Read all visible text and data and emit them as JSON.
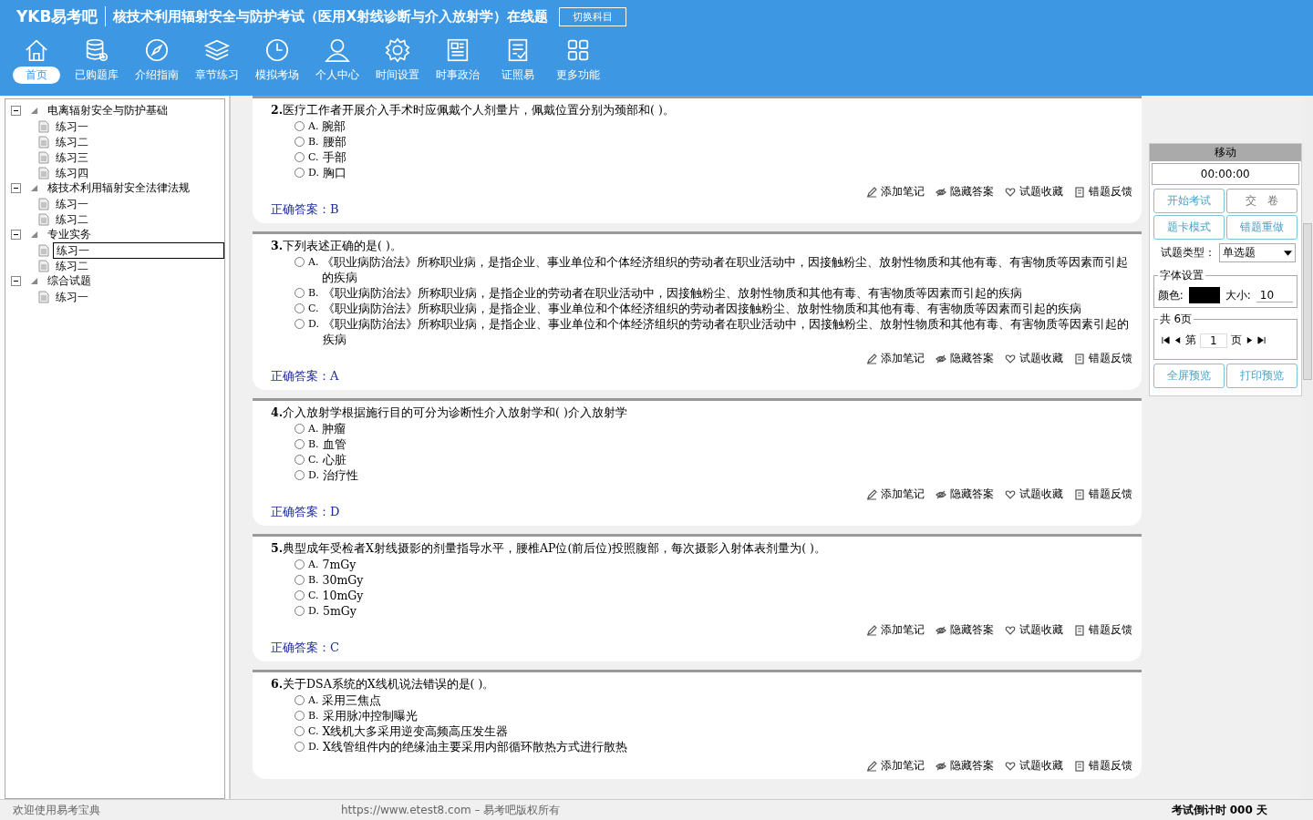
{
  "header": {
    "logo": "YKB易考吧",
    "title": "核技术利用辐射安全与防护考试（医用X射线诊断与介入放射学）在线题",
    "switch_button": "切换科目"
  },
  "toolbar": [
    {
      "kind": "home",
      "label": "首页",
      "selected": true
    },
    {
      "kind": "database",
      "label": "已购题库",
      "selected": false
    },
    {
      "kind": "compass",
      "label": "介绍指南",
      "selected": false
    },
    {
      "kind": "layers",
      "label": "章节练习",
      "selected": false
    },
    {
      "kind": "clock",
      "label": "模拟考场",
      "selected": false
    },
    {
      "kind": "user",
      "label": "个人中心",
      "selected": false
    },
    {
      "kind": "gear",
      "label": "时间设置",
      "selected": false
    },
    {
      "kind": "news",
      "label": "时事政治",
      "selected": false
    },
    {
      "kind": "checklist",
      "label": "证照易",
      "selected": false
    },
    {
      "kind": "grid",
      "label": "更多功能",
      "selected": false
    }
  ],
  "tree": [
    {
      "label": "电离辐射安全与防护基础",
      "expanded": true,
      "children": [
        {
          "label": "练习一",
          "selected": false
        },
        {
          "label": "练习二",
          "selected": false
        },
        {
          "label": "练习三",
          "selected": false
        },
        {
          "label": "练习四",
          "selected": false
        }
      ]
    },
    {
      "label": "核技术利用辐射安全法律法规",
      "expanded": true,
      "children": [
        {
          "label": "练习一",
          "selected": false
        },
        {
          "label": "练习二",
          "selected": false
        }
      ]
    },
    {
      "label": "专业实务",
      "expanded": true,
      "children": [
        {
          "label": "练习一",
          "selected": true
        },
        {
          "label": "练习二",
          "selected": false
        }
      ]
    },
    {
      "label": "综合试题",
      "expanded": true,
      "children": [
        {
          "label": "练习一",
          "selected": false
        }
      ]
    }
  ],
  "questions": [
    {
      "number": "2.",
      "text": "医疗工作者开展介入手术时应佩戴个人剂量片，佩戴位置分别为颈部和( )。",
      "options": [
        {
          "letter": "A.",
          "text": "腕部",
          "selected": false
        },
        {
          "letter": "B.",
          "text": "腰部",
          "selected": false
        },
        {
          "letter": "C.",
          "text": "手部",
          "selected": false
        },
        {
          "letter": "D.",
          "text": "胸口",
          "selected": false
        }
      ],
      "actions": [
        "添加笔记",
        "隐藏答案",
        "试题收藏",
        "错题反馈"
      ],
      "answer_label": "正确答案：",
      "answer": "B"
    },
    {
      "number": "3.",
      "text": "下列表述正确的是( )。",
      "options": [
        {
          "letter": "A.",
          "text": "《职业病防治法》所称职业病，是指企业、事业单位和个体经济组织的劳动者在职业活动中，因接触粉尘、放射性物质和其他有毒、有害物质等因素而引起的疾病",
          "selected": false
        },
        {
          "letter": "B.",
          "text": "《职业病防治法》所称职业病，是指企业的劳动者在职业活动中，因接触粉尘、放射性物质和其他有毒、有害物质等因素而引起的疾病",
          "selected": false
        },
        {
          "letter": "C.",
          "text": "《职业病防治法》所称职业病，是指企业、事业单位和个体经济组织的劳动者因接触粉尘、放射性物质和其他有毒、有害物质等因素而引起的疾病",
          "selected": false
        },
        {
          "letter": "D.",
          "text": "《职业病防治法》所称职业病，是指企业、事业单位和个体经济组织的劳动者在职业活动中，因接触粉尘、放射性物质和其他有毒、有害物质等因素引起的疾病",
          "selected": false
        }
      ],
      "actions": [
        "添加笔记",
        "隐藏答案",
        "试题收藏",
        "错题反馈"
      ],
      "answer_label": "正确答案：",
      "answer": "A"
    },
    {
      "number": "4.",
      "text": "介入放射学根据施行目的可分为诊断性介入放射学和( )介入放射学",
      "options": [
        {
          "letter": "A.",
          "text": "肿瘤",
          "selected": false
        },
        {
          "letter": "B.",
          "text": "血管",
          "selected": false
        },
        {
          "letter": "C.",
          "text": "心脏",
          "selected": false
        },
        {
          "letter": "D.",
          "text": "治疗性",
          "selected": false
        }
      ],
      "actions": [
        "添加笔记",
        "隐藏答案",
        "试题收藏",
        "错题反馈"
      ],
      "answer_label": "正确答案：",
      "answer": "D"
    },
    {
      "number": "5.",
      "text": "典型成年受检者X射线摄影的剂量指导水平，腰椎AP位(前后位)投照腹部，每次摄影入射体表剂量为( )。",
      "options": [
        {
          "letter": "A.",
          "text": "7mGy",
          "selected": false
        },
        {
          "letter": "B.",
          "text": "30mGy",
          "selected": false
        },
        {
          "letter": "C.",
          "text": "10mGy",
          "selected": false
        },
        {
          "letter": "D.",
          "text": "5mGy",
          "selected": false
        }
      ],
      "actions": [
        "添加笔记",
        "隐藏答案",
        "试题收藏",
        "错题反馈"
      ],
      "answer_label": "正确答案：",
      "answer": "C"
    },
    {
      "number": "6.",
      "text": "关于DSA系统的X线机说法错误的是( )。",
      "options": [
        {
          "letter": "A.",
          "text": "采用三焦点",
          "selected": false
        },
        {
          "letter": "B.",
          "text": "采用脉冲控制曝光",
          "selected": false
        },
        {
          "letter": "C.",
          "text": "X线机大多采用逆变高频高压发生器",
          "selected": false
        },
        {
          "letter": "D.",
          "text": "X线管组件内的绝缘油主要采用内部循环散热方式进行散热",
          "selected": false
        }
      ],
      "actions": [
        "添加笔记",
        "隐藏答案",
        "试题收藏",
        "错题反馈"
      ]
    }
  ],
  "panel": {
    "title": "移动",
    "timer": "00:00:00",
    "buttons": [
      "开始考试",
      "交　卷",
      "题卡模式",
      "错题重做"
    ],
    "type_label": "试题类型：",
    "type_value": "单选题",
    "font_legend": "字体设置",
    "color_label": "颜色:",
    "color": "#000000",
    "size_label": "大小:",
    "size_value": "10",
    "page_legend": "共 6页",
    "page_prefix": "第",
    "page_value": "1",
    "page_suffix": "页",
    "bottom_buttons": [
      "全屏预览",
      "打印预览"
    ]
  },
  "status_bar": {
    "welcome": "欢迎使用易考宝典",
    "copyright": "https://www.etest8.com – 易考吧版权所有",
    "countdown": "考试倒计时 000 天"
  }
}
